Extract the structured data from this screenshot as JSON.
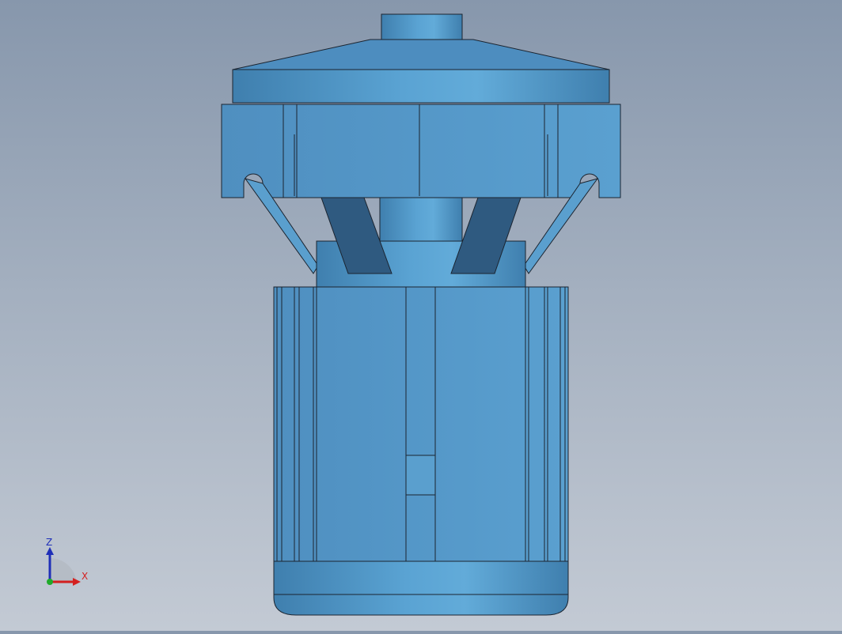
{
  "viewport": {
    "background_top": "#8797ac",
    "background_bottom": "#c3cad4",
    "model_color": "#5b9dc9",
    "model_edge_color": "#1b2430"
  },
  "triad": {
    "z_label": "Z",
    "x_label": "X",
    "z_color": "#1f2fb8",
    "x_color": "#d42020",
    "y_color": "#1faa2a"
  }
}
